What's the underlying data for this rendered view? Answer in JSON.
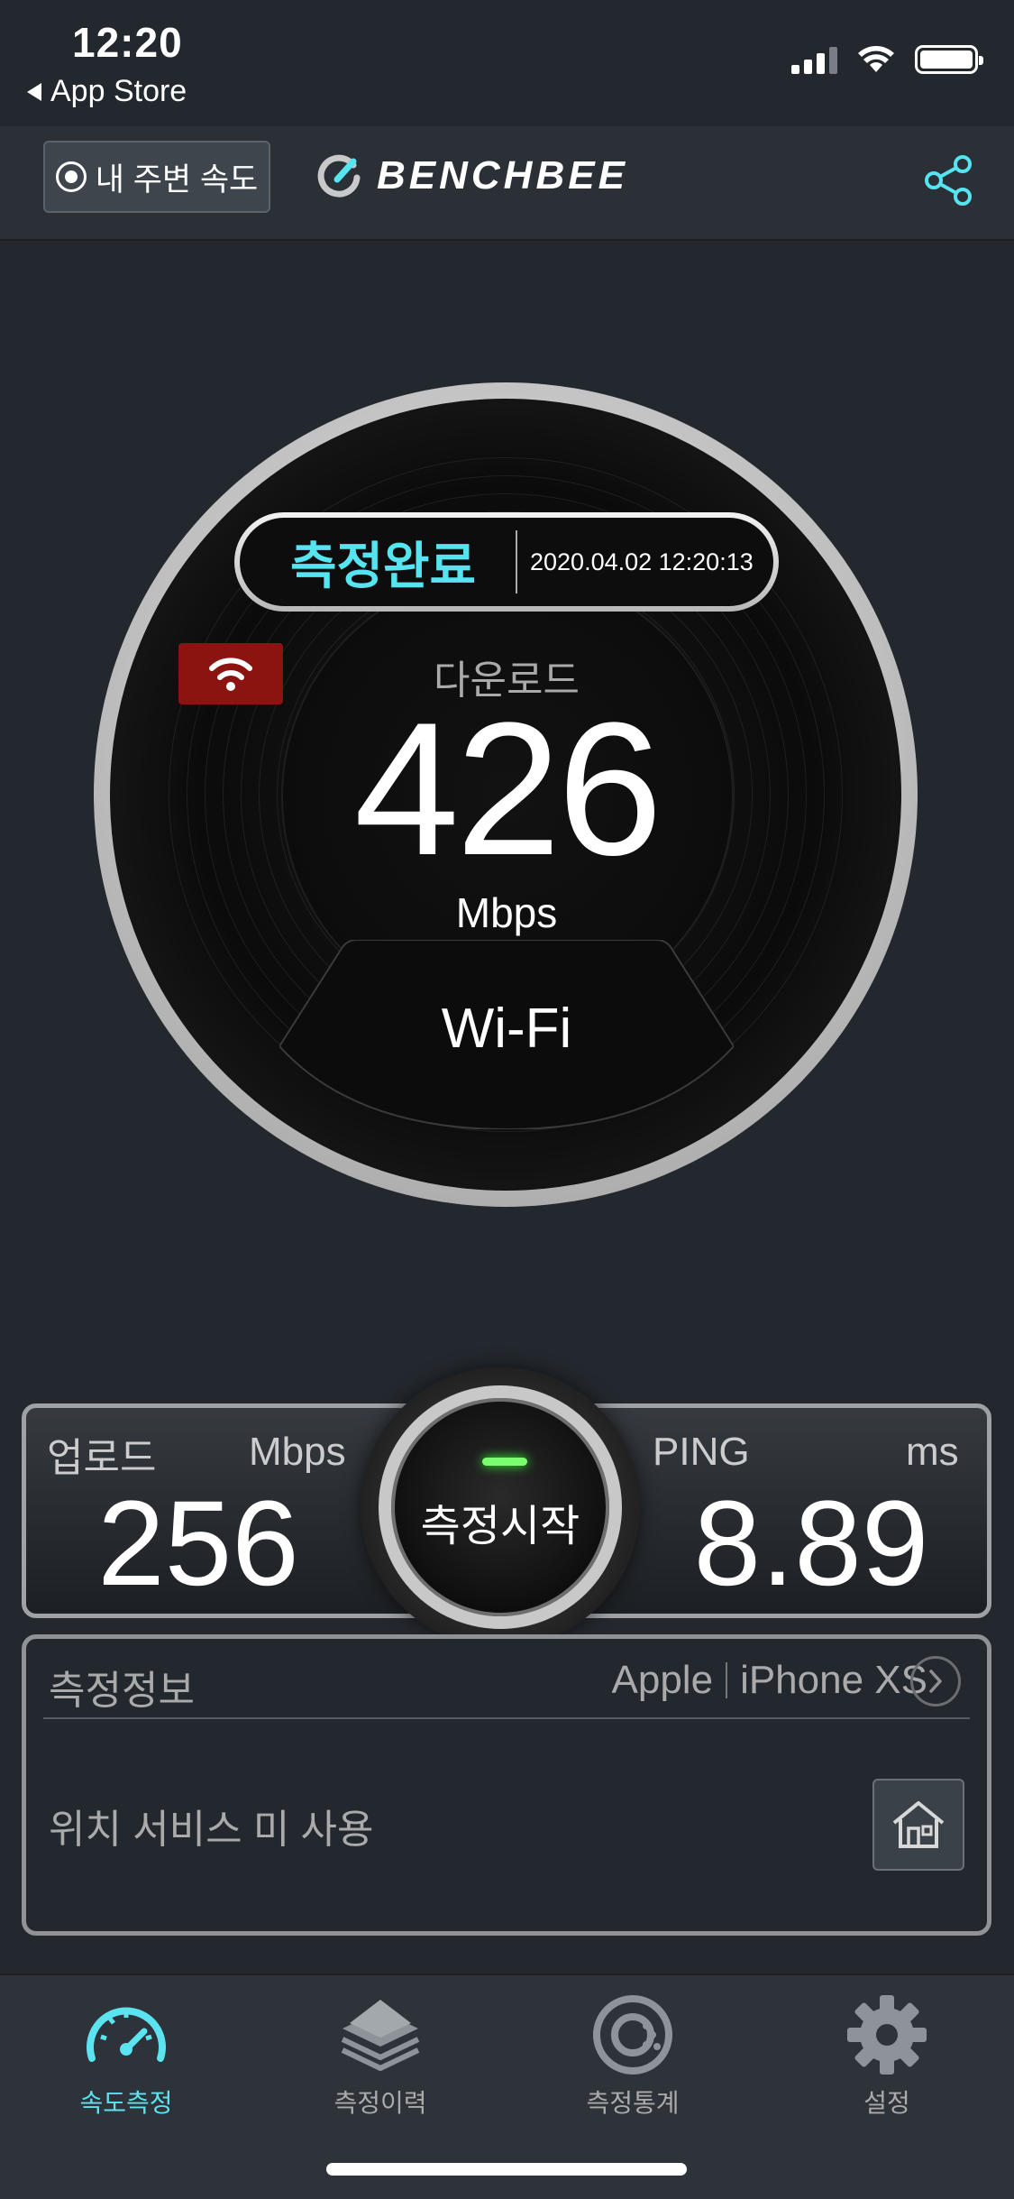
{
  "status_bar": {
    "time": "12:20",
    "back_label": "App Store",
    "icons": [
      "cellular-signal-icon",
      "wifi-icon",
      "battery-icon"
    ]
  },
  "header": {
    "nearby_button": "내 주변 속도",
    "logo_text": "BENCHBEE",
    "share_icon": "share-icon"
  },
  "gauge": {
    "status": "측정완료",
    "datetime": "2020.04.02 12:20:13",
    "download_label": "다운로드",
    "download_value": "426",
    "download_unit": "Mbps",
    "network_type": "Wi-Fi",
    "network_icon": "wifi-icon"
  },
  "stats": {
    "upload_label": "업로드",
    "upload_unit": "Mbps",
    "upload_value": "256",
    "ping_label": "PING",
    "ping_unit": "ms",
    "ping_value": "8.89",
    "start_button": "측정시작"
  },
  "info": {
    "title": "측정정보",
    "device_brand": "Apple",
    "device_model": "iPhone XS",
    "location_text": "위치 서비스 미 사용"
  },
  "tabs": [
    {
      "label": "속도측정",
      "icon": "speedometer-icon",
      "active": true
    },
    {
      "label": "측정이력",
      "icon": "layers-icon",
      "active": false
    },
    {
      "label": "측정통계",
      "icon": "statistics-icon",
      "active": false
    },
    {
      "label": "설정",
      "icon": "gear-icon",
      "active": false
    }
  ],
  "colors": {
    "accent": "#55e4f0",
    "background": "#23282e",
    "wifi_badge": "#8c1410",
    "led": "#7cff6e"
  }
}
